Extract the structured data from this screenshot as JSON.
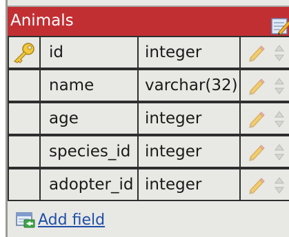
{
  "table": {
    "title": "Animals",
    "fields": [
      {
        "name": "id",
        "type": "integer",
        "primary_key": true
      },
      {
        "name": "name",
        "type": "varchar(32)",
        "primary_key": false
      },
      {
        "name": "age",
        "type": "integer",
        "primary_key": false
      },
      {
        "name": "species_id",
        "type": "integer",
        "primary_key": false
      },
      {
        "name": "adopter_id",
        "type": "integer",
        "primary_key": false
      }
    ],
    "add_field_label": "Add field"
  },
  "colors": {
    "header": "#c22f33",
    "body": "#e8e8e4",
    "grid_line": "#2e2e2e",
    "link": "#1f4fa8"
  },
  "icons": {
    "primary_key": "key-icon",
    "edit_field": "pencil-icon",
    "reorder": "up-down-arrows-icon",
    "edit_table": "edit-table-icon",
    "add_field": "add-field-icon"
  }
}
